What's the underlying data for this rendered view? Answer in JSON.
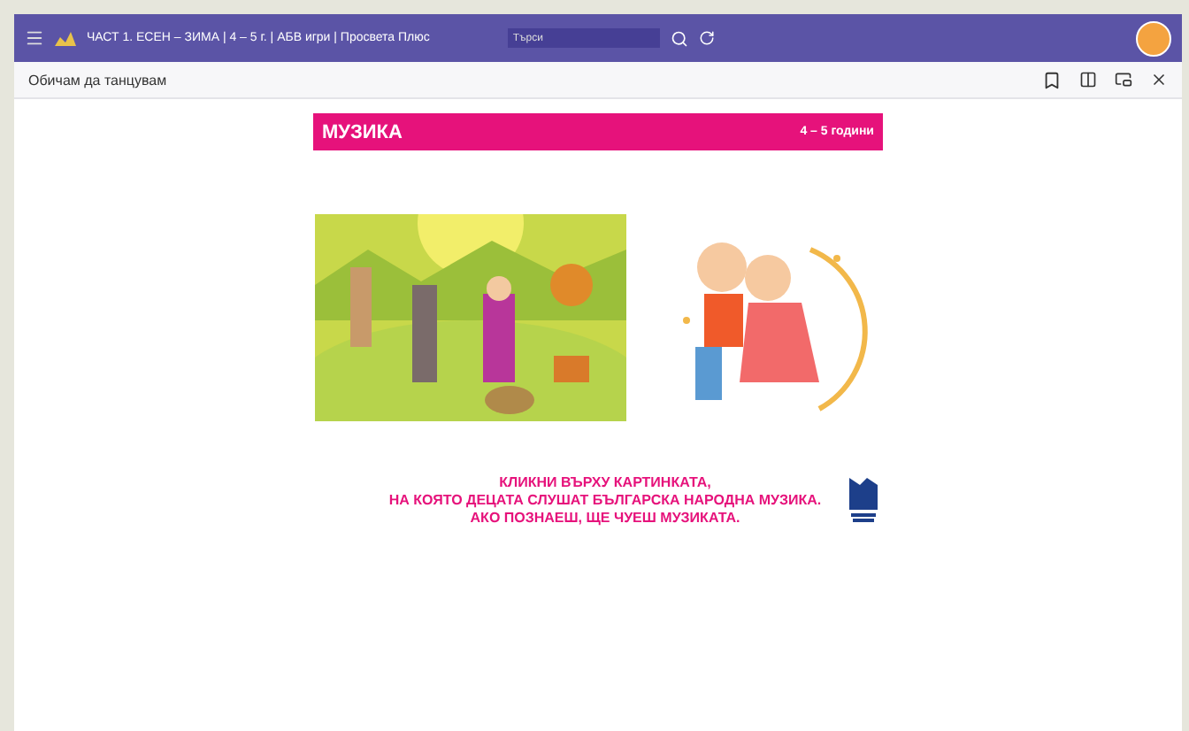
{
  "header": {
    "breadcrumb": "ЧАСТ 1. ЕСЕН – ЗИМА | 4 – 5 г. | АБВ игри | Просвета Плюс",
    "search": {
      "placeholder": "Търси"
    }
  },
  "toolbar": {
    "title": "Обичам да танцувам"
  },
  "page": {
    "banner": {
      "subject": "МУЗИКА",
      "age": "4 – 5 години"
    },
    "instructions": [
      "КЛИКНИ ВЪРХУ КАРТИНКАТА,",
      "НА КОЯТО ДЕЦАТА СЛУШАТ БЪЛГАРСКА НАРОДНА МУЗИКА.",
      "АКО ПОЗНАЕШ, ЩЕ ЧУЕШ МУЗИКАТА."
    ]
  }
}
